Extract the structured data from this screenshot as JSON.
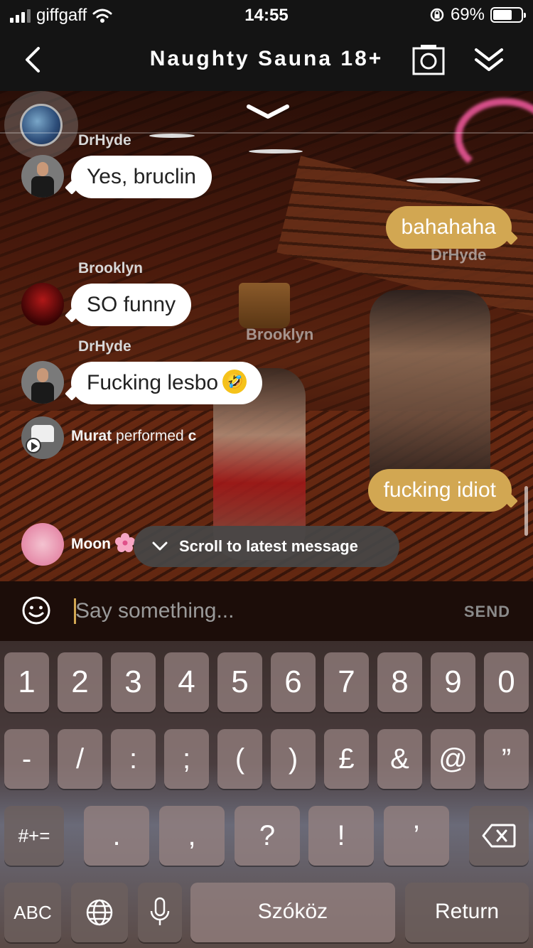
{
  "status_bar": {
    "carrier": "giffgaff",
    "time": "14:55",
    "battery_percent": "69%",
    "battery_level": 0.69
  },
  "nav": {
    "title": "Naughty Sauna 18+"
  },
  "scene": {
    "labels": [
      "DrHyde",
      "Brooklyn"
    ]
  },
  "chat": {
    "messages": [
      {
        "sender": "DrHyde",
        "text": "Yes, bruclin",
        "mine": false
      },
      {
        "sender": "",
        "text": "bahahaha",
        "mine": true
      },
      {
        "sender": "Brooklyn",
        "text": "SO funny",
        "mine": false
      },
      {
        "sender": "DrHyde",
        "text": "Fucking lesbo",
        "emoji": "🤣",
        "mine": false
      },
      {
        "sender": "",
        "text": "fucking idiot",
        "mine": true
      }
    ],
    "action": {
      "user": "Murat",
      "verb": "performed",
      "target": "c"
    },
    "last_user": "Moon",
    "scroll_latest_label": "Scroll to latest message"
  },
  "input": {
    "placeholder": "Say something...",
    "send_label": "SEND"
  },
  "keyboard": {
    "row1": [
      "1",
      "2",
      "3",
      "4",
      "5",
      "6",
      "7",
      "8",
      "9",
      "0"
    ],
    "row2": [
      "-",
      "/",
      ":",
      ";",
      "(",
      ")",
      "£",
      "&",
      "@",
      "”"
    ],
    "row3_mode": "#+=",
    "row3": [
      ".",
      ",",
      "?",
      "!",
      "’"
    ],
    "abc_label": "ABC",
    "space_label": "Szóköz",
    "return_label": "Return"
  }
}
